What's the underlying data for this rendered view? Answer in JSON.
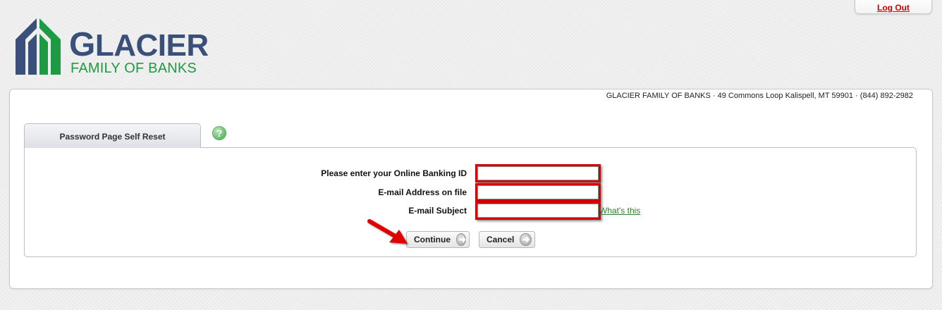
{
  "header": {
    "logout_label": "Log Out"
  },
  "logo": {
    "name_main_first": "G",
    "name_main_rest": "LACIER",
    "name_sub": "FAMILY OF BANKS",
    "colors": {
      "navy": "#3a4f7a",
      "green": "#1f9a44"
    }
  },
  "bank_info": "GLACIER FAMILY OF BANKS · 49 Commons Loop Kalispell, MT 59901 · (844) 892-2982",
  "tab": {
    "label": "Password Page Self Reset",
    "help_icon": "?"
  },
  "form": {
    "fields": [
      {
        "label": "Please enter your Online Banking ID",
        "value": "",
        "placeholder": ""
      },
      {
        "label": "E-mail Address on file",
        "value": "",
        "placeholder": ""
      },
      {
        "label": "E-mail Subject",
        "value": "",
        "placeholder": ""
      }
    ],
    "whats_this_label": "What's this",
    "continue_label": "Continue",
    "cancel_label": "Cancel"
  },
  "icons": {
    "help": "help-icon",
    "continue": "arrow-right-circle-icon",
    "cancel": "arrow-right-circle-icon",
    "annotation": "red-pointer-arrow-icon"
  },
  "colors": {
    "highlight_border": "#d20000",
    "link_green": "#2e7d32",
    "logout_red": "#cc0000"
  }
}
